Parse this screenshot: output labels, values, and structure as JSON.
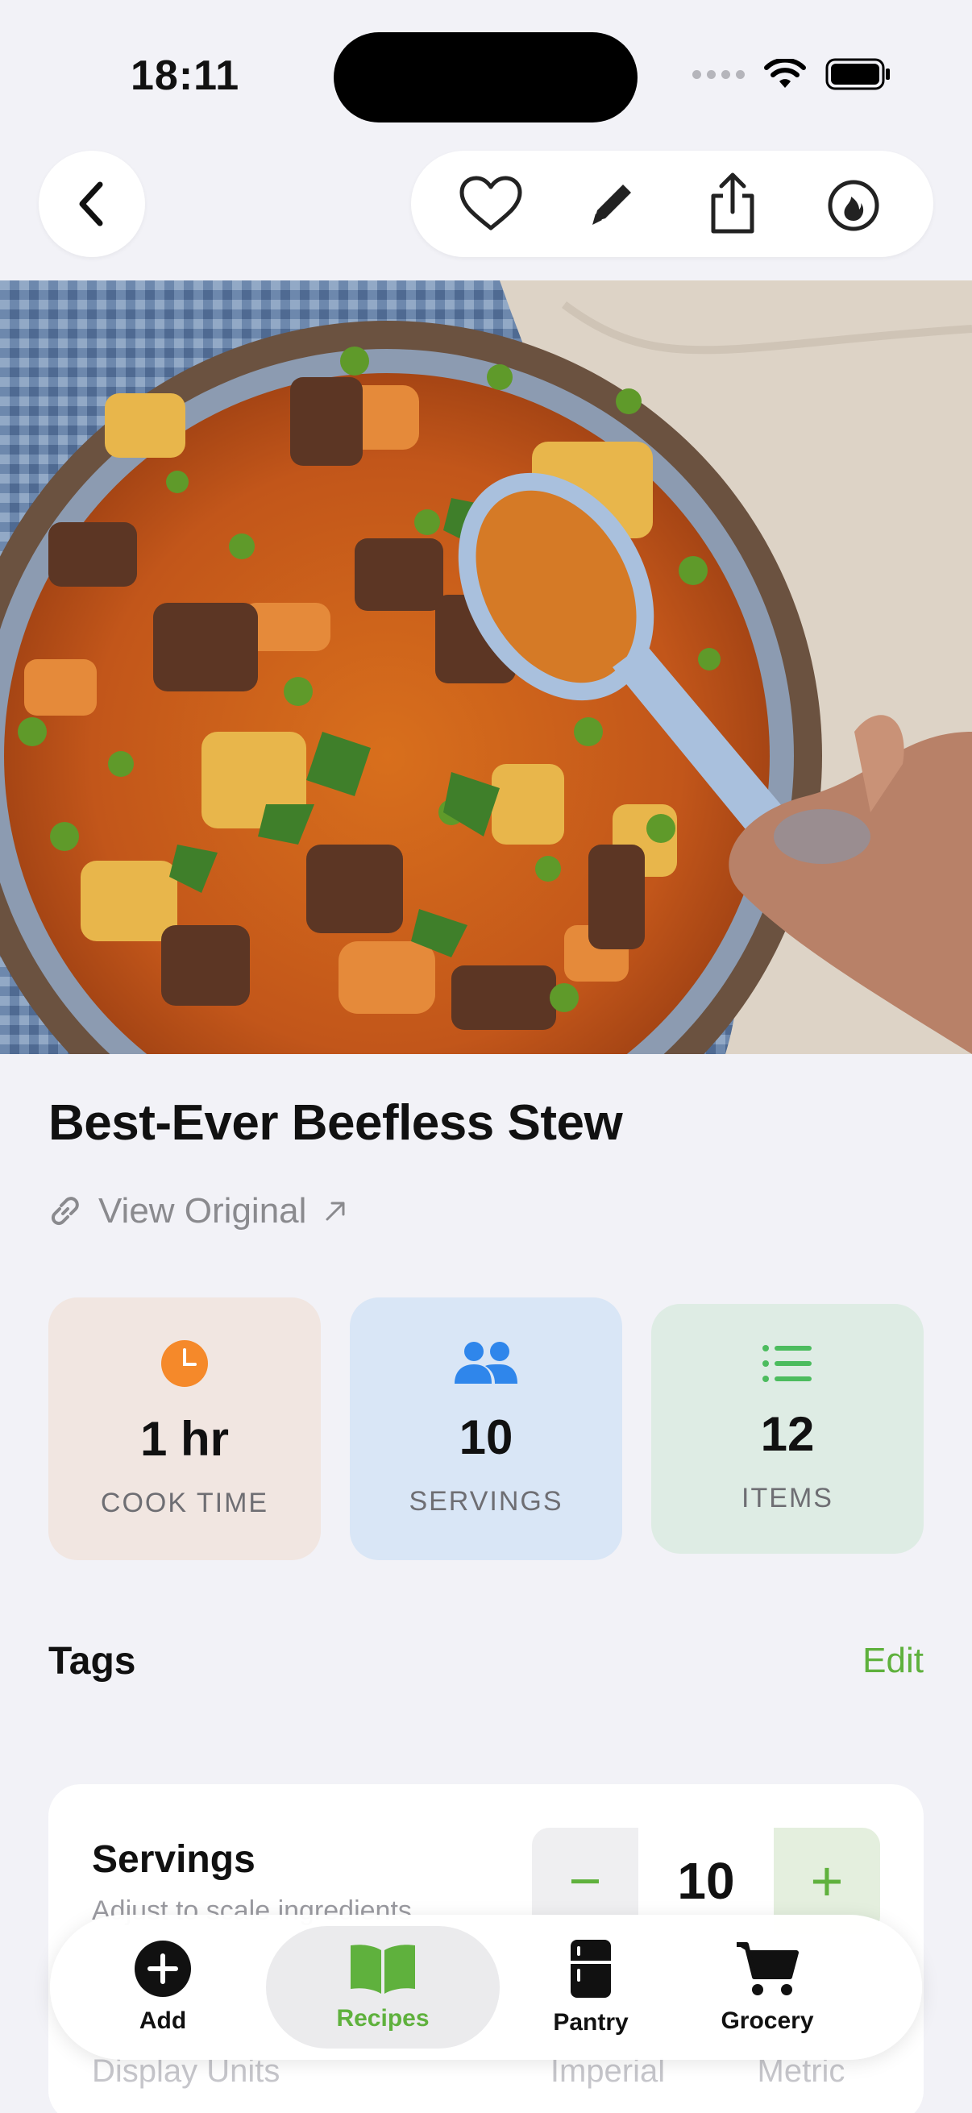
{
  "status_bar": {
    "time": "18:11"
  },
  "nav": {
    "back_icon": "chevron-left-icon",
    "actions": [
      "heart-icon",
      "pencil-icon",
      "share-icon",
      "flame-icon"
    ]
  },
  "recipe": {
    "title": "Best-Ever Beefless Stew",
    "view_original": "View Original"
  },
  "stats": [
    {
      "value": "1 hr",
      "label": "COOK TIME",
      "icon": "clock-icon",
      "color": "#f5892a"
    },
    {
      "value": "10",
      "label": "SERVINGS",
      "icon": "people-icon",
      "color": "#2f86eb"
    },
    {
      "value": "12",
      "label": "ITEMS",
      "icon": "list-icon",
      "color": "#4cbc5e"
    }
  ],
  "tags": {
    "title": "Tags",
    "edit_label": "Edit"
  },
  "servings": {
    "title": "Servings",
    "subtitle": "Adjust to scale ingredients",
    "minus": "−",
    "value": "10",
    "plus": "+",
    "units_label": "Display Units",
    "unit_imperial": "Imperial",
    "unit_metric": "Metric"
  },
  "tab_bar": {
    "add": "Add",
    "recipes": "Recipes",
    "pantry": "Pantry",
    "grocery": "Grocery",
    "active": "Recipes"
  },
  "colors": {
    "accent": "#5fb13d",
    "background": "#f2f2f7"
  }
}
